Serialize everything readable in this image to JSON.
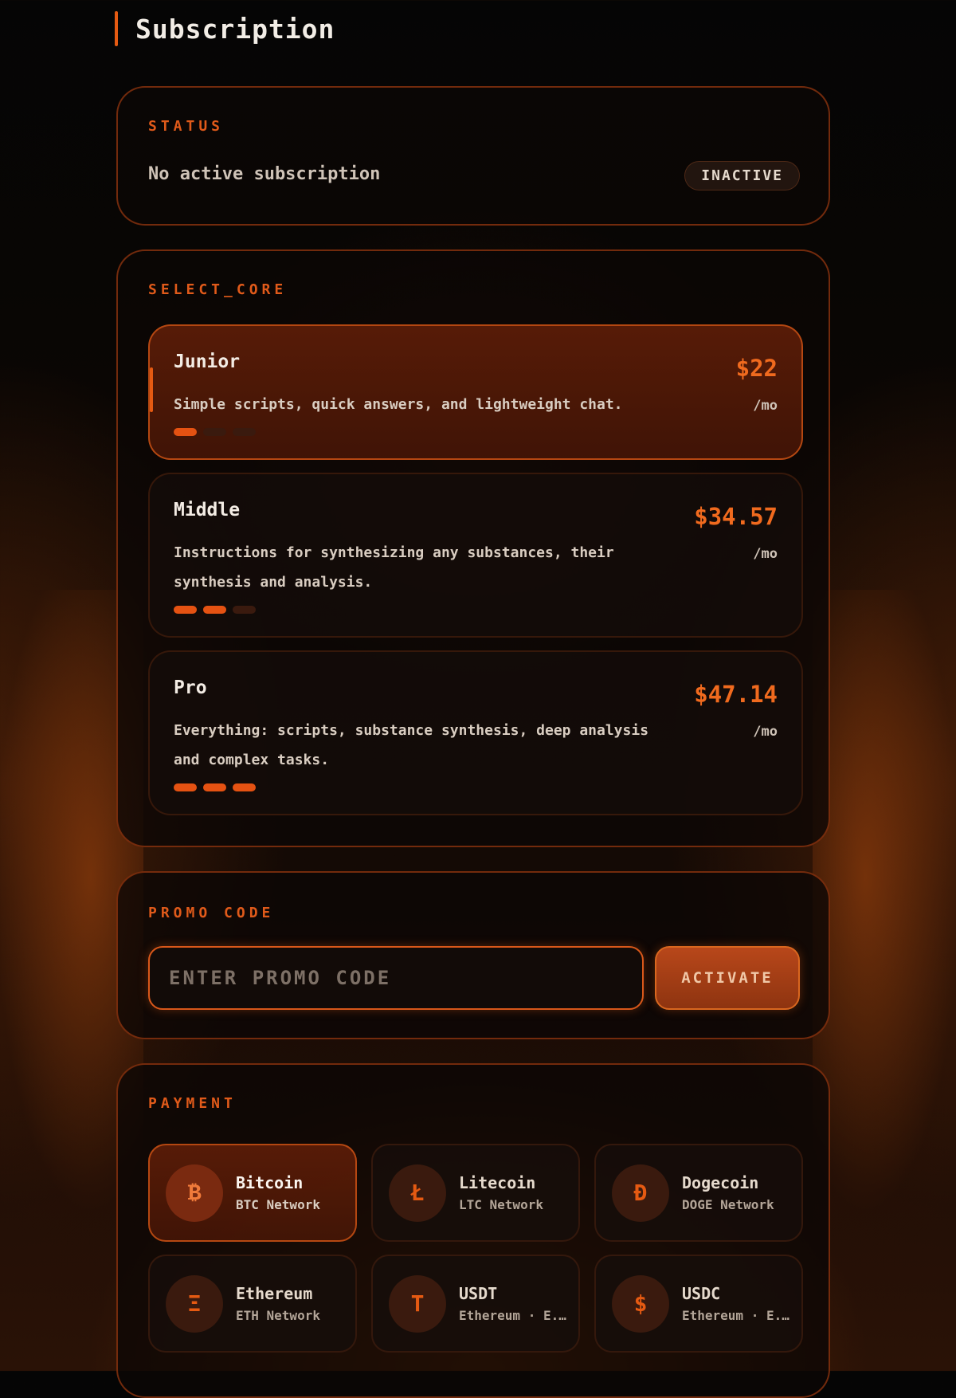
{
  "page": {
    "title": "Subscription"
  },
  "status": {
    "label": "STATUS",
    "text": "No active subscription",
    "badge": "INACTIVE"
  },
  "plans": {
    "label": "SELECT_CORE",
    "items": [
      {
        "name": "Junior",
        "description": "Simple scripts, quick answers, and lightweight chat.",
        "price": "$22",
        "period": "/mo",
        "tier_level": 1,
        "tier_max": 3,
        "selected": true
      },
      {
        "name": "Middle",
        "description": "Instructions for synthesizing any substances, their synthesis and analysis.",
        "price": "$34.57",
        "period": "/mo",
        "tier_level": 2,
        "tier_max": 3,
        "selected": false
      },
      {
        "name": "Pro",
        "description": "Everything: scripts, substance synthesis, deep analysis and complex tasks.",
        "price": "$47.14",
        "period": "/mo",
        "tier_level": 3,
        "tier_max": 3,
        "selected": false
      }
    ]
  },
  "promo": {
    "label": "PROMO CODE",
    "placeholder": "ENTER PROMO CODE",
    "value": "",
    "button_label": "ACTIVATE"
  },
  "payment": {
    "label": "PAYMENT",
    "methods": [
      {
        "name": "Bitcoin",
        "network": "BTC Network",
        "symbol": "₿",
        "icon": "bitcoin-icon",
        "selected": true
      },
      {
        "name": "Litecoin",
        "network": "LTC Network",
        "symbol": "Ł",
        "icon": "litecoin-icon",
        "selected": false
      },
      {
        "name": "Dogecoin",
        "network": "DOGE Network",
        "symbol": "Đ",
        "icon": "dogecoin-icon",
        "selected": false
      },
      {
        "name": "Ethereum",
        "network": "ETH Network",
        "symbol": "Ξ",
        "icon": "ethereum-icon",
        "selected": false
      },
      {
        "name": "USDT",
        "network": "Ethereum · E...",
        "symbol": "T",
        "icon": "tether-icon",
        "selected": false
      },
      {
        "name": "USDC",
        "network": "Ethereum · E...",
        "symbol": "$",
        "icon": "usdc-icon",
        "selected": false
      }
    ]
  },
  "colors": {
    "accent": "#e55a12",
    "price": "#f06a1e",
    "background": "#0a0604",
    "panel_border": "#96370f"
  }
}
